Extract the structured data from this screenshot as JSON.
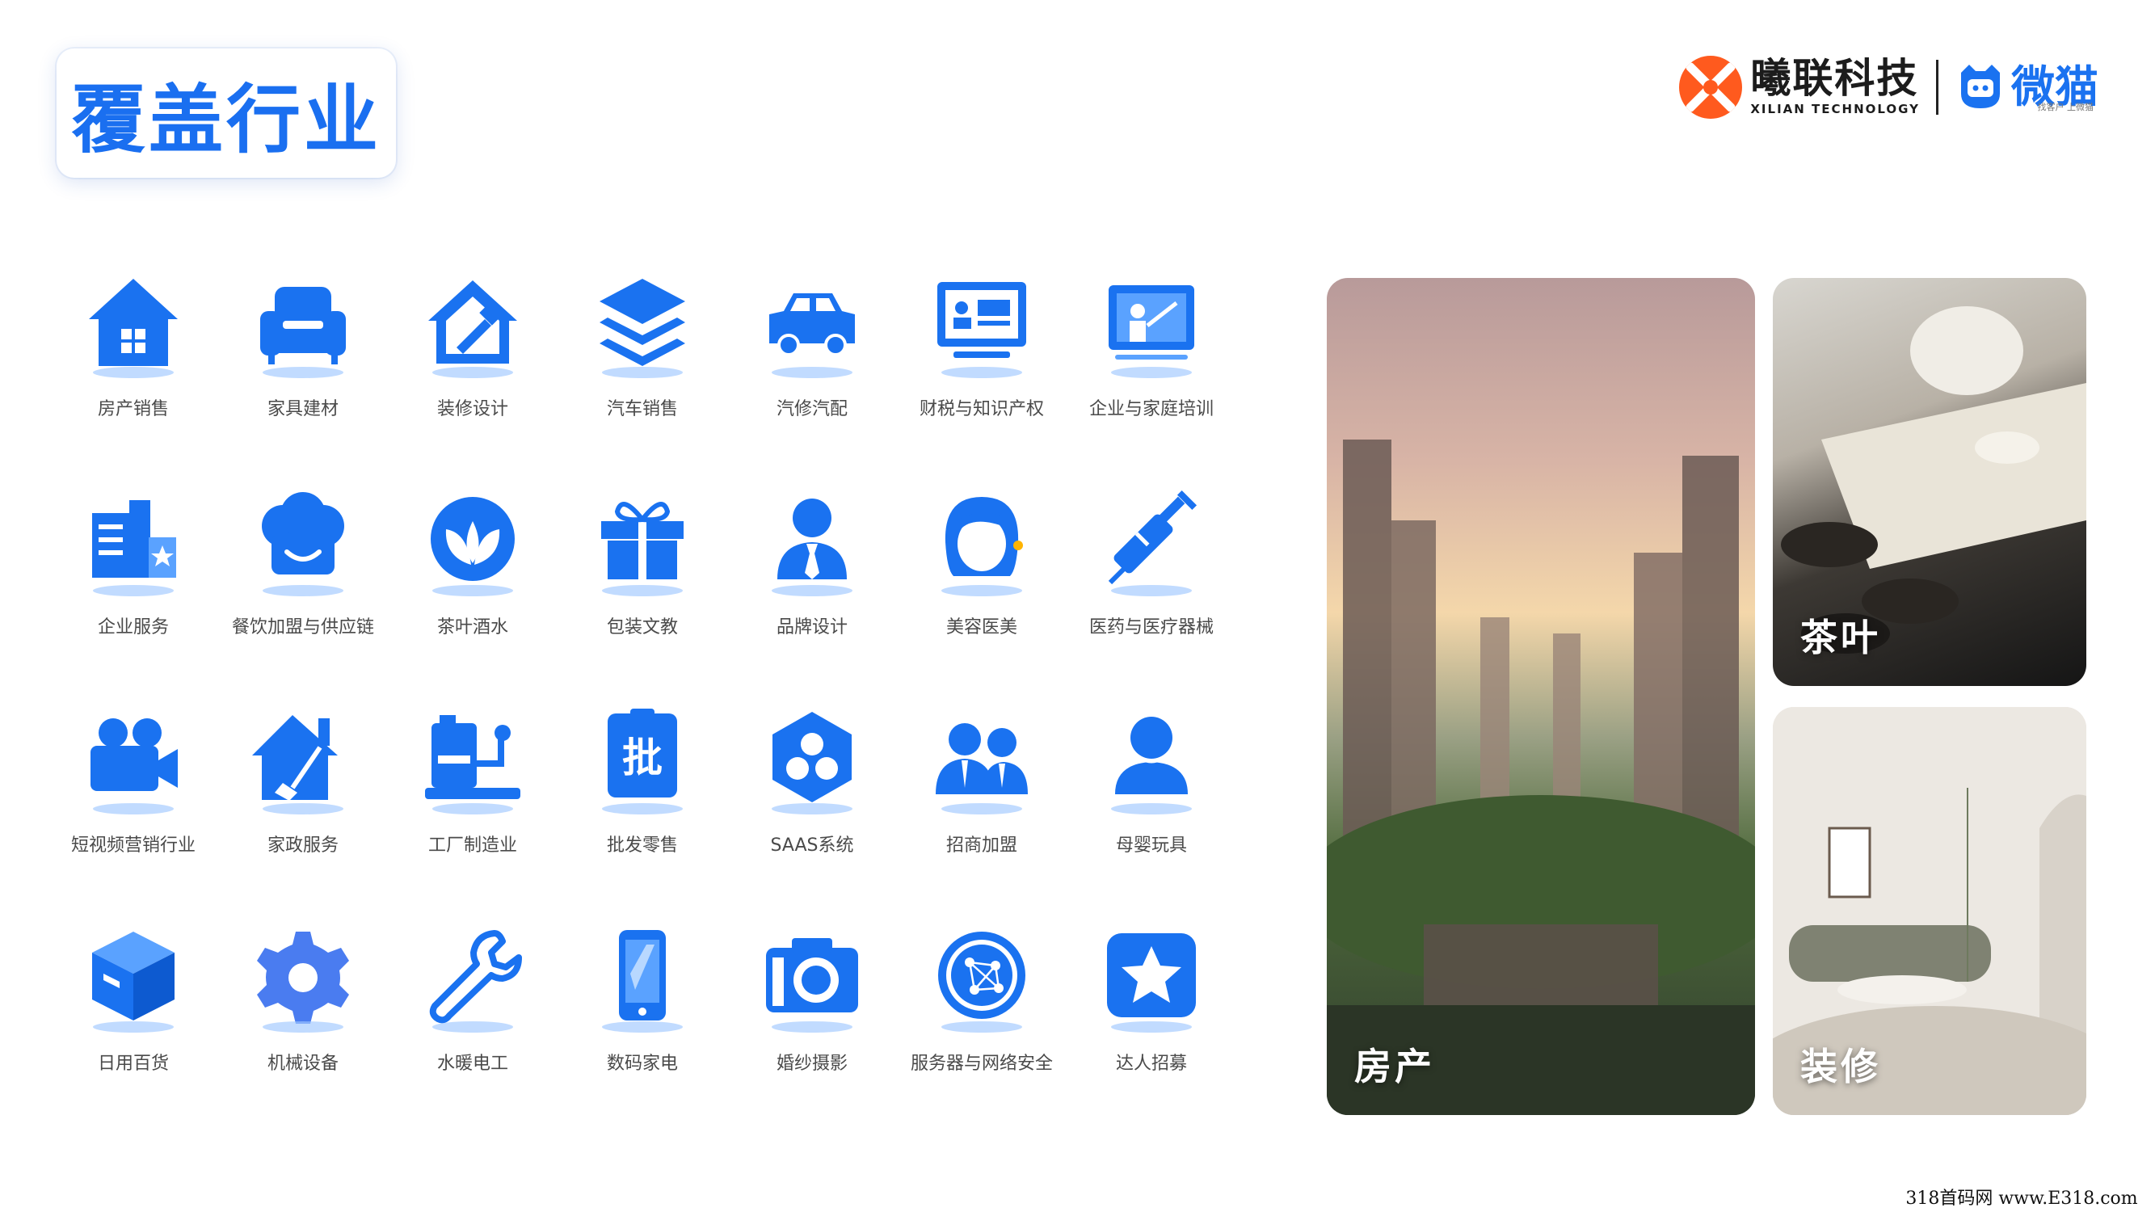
{
  "header": {
    "title": "覆盖行业",
    "brand_name": "曦联科技",
    "brand_en": "XILIAN TECHNOLOGY",
    "partner_name": "微猫",
    "partner_sub": "找客户 上微猫"
  },
  "industries": [
    {
      "label": "房产销售",
      "icon": "house-icon"
    },
    {
      "label": "家具建材",
      "icon": "sofa-icon"
    },
    {
      "label": "装修设计",
      "icon": "renovation-icon"
    },
    {
      "label": "汽车销售",
      "icon": "layers-icon"
    },
    {
      "label": "汽修汽配",
      "icon": "car-icon"
    },
    {
      "label": "财税与知识产权",
      "icon": "monitor-icon"
    },
    {
      "label": "企业与家庭培训",
      "icon": "training-icon"
    },
    {
      "label": "企业服务",
      "icon": "building-icon"
    },
    {
      "label": "餐饮加盟与供应链",
      "icon": "chef-hat-icon"
    },
    {
      "label": "茶叶酒水",
      "icon": "leaf-icon"
    },
    {
      "label": "包装文教",
      "icon": "gift-box-icon"
    },
    {
      "label": "品牌设计",
      "icon": "person-tie-icon"
    },
    {
      "label": "美容医美",
      "icon": "woman-icon"
    },
    {
      "label": "医药与医疗器械",
      "icon": "syringe-icon"
    },
    {
      "label": "短视频营销行业",
      "icon": "video-camera-icon"
    },
    {
      "label": "家政服务",
      "icon": "house-broom-icon"
    },
    {
      "label": "工厂制造业",
      "icon": "factory-machine-icon"
    },
    {
      "label": "批发零售",
      "icon": "wholesale-icon"
    },
    {
      "label": "SAAS系统",
      "icon": "hexagon-icon"
    },
    {
      "label": "招商加盟",
      "icon": "group-icon"
    },
    {
      "label": "母婴玩具",
      "icon": "user-icon"
    },
    {
      "label": "日用百货",
      "icon": "cube-box-icon"
    },
    {
      "label": "机械设备",
      "icon": "gear-icon"
    },
    {
      "label": "水暖电工",
      "icon": "wrench-icon"
    },
    {
      "label": "数码家电",
      "icon": "phone-icon"
    },
    {
      "label": "婚纱摄影",
      "icon": "camera-icon"
    },
    {
      "label": "服务器与网络安全",
      "icon": "globe-icon"
    },
    {
      "label": "达人招募",
      "icon": "star-icon"
    }
  ],
  "photos": [
    {
      "label": "房产"
    },
    {
      "label": "茶叶"
    },
    {
      "label": "装修"
    }
  ],
  "watermark": "318首码网 www.E318.com",
  "colors": {
    "accent": "#1a6ff0",
    "icon": "#1a72f0",
    "brand_orange": "#ff5a1e"
  }
}
